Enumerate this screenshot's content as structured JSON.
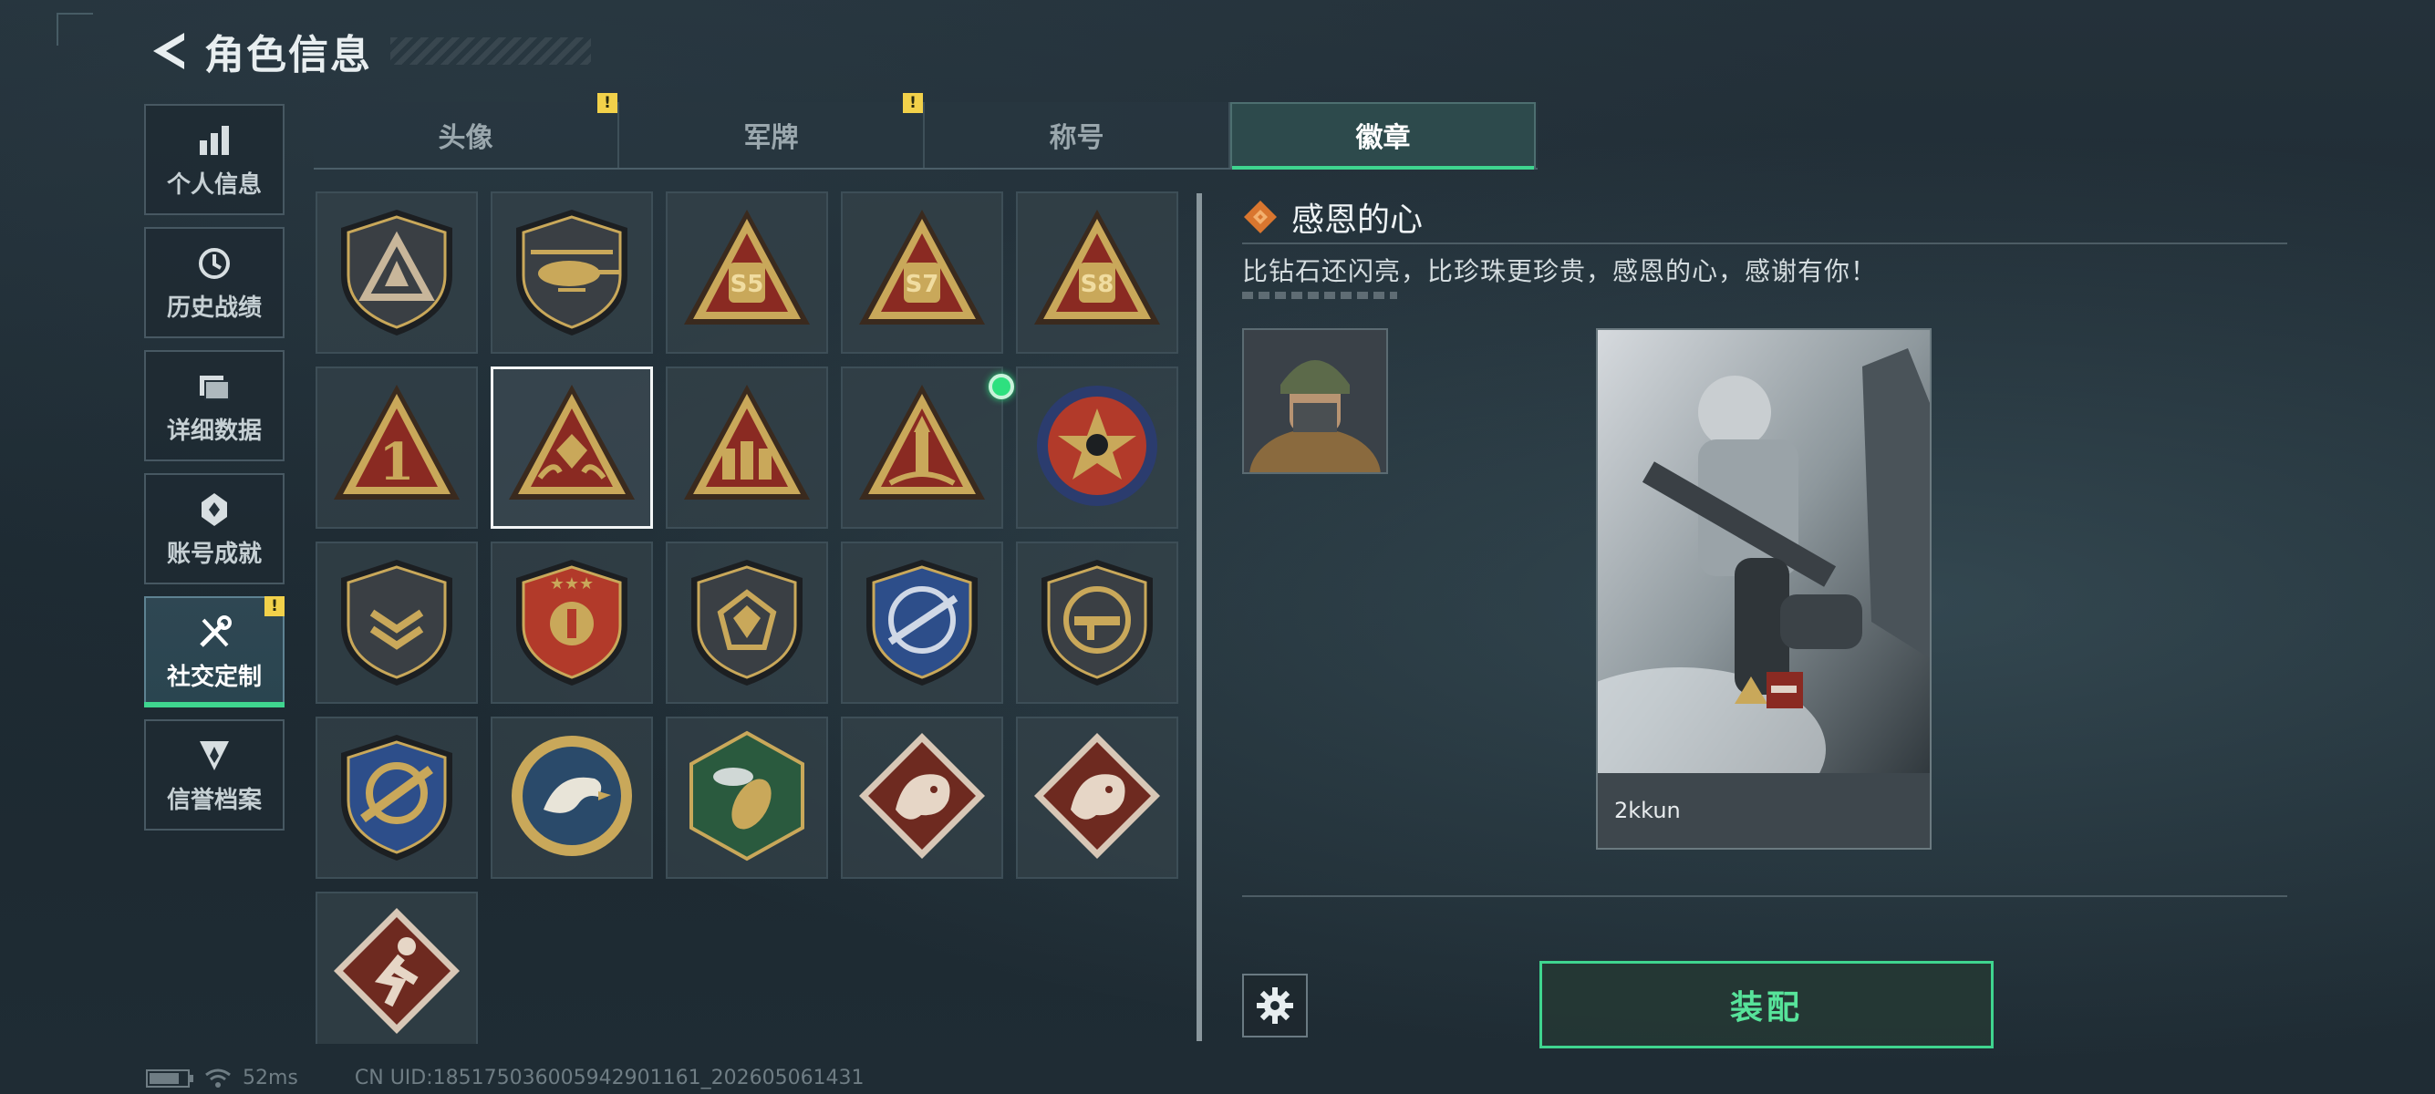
{
  "header": {
    "title": "角色信息"
  },
  "nav": [
    {
      "label": "个人信息",
      "icon": "bar-chart-icon",
      "active": false,
      "warning": false
    },
    {
      "label": "历史战绩",
      "icon": "history-icon",
      "active": false,
      "warning": false
    },
    {
      "label": "详细数据",
      "icon": "folder-icon",
      "active": false,
      "warning": false
    },
    {
      "label": "账号成就",
      "icon": "achievement-icon",
      "active": false,
      "warning": false
    },
    {
      "label": "社交定制",
      "icon": "tools-icon",
      "active": true,
      "warning": true,
      "warning_text": "!"
    },
    {
      "label": "信誉档案",
      "icon": "credit-icon",
      "active": false,
      "warning": false
    }
  ],
  "tabs": [
    {
      "label": "头像",
      "warning": true,
      "warning_text": "!"
    },
    {
      "label": "军牌",
      "warning": true,
      "warning_text": "!"
    },
    {
      "label": "称号",
      "warning": false
    },
    {
      "label": "徽章",
      "active": true,
      "warning": false
    }
  ],
  "badges": [
    {
      "name": "badge-triangle-emblem",
      "icon": "triangle-shield-icon",
      "selected": false
    },
    {
      "name": "badge-helicopter",
      "icon": "helicopter-shield-icon",
      "selected": false
    },
    {
      "name": "badge-s5",
      "icon": "s5-triangle-icon",
      "text": "S5",
      "selected": false
    },
    {
      "name": "badge-s7",
      "icon": "s7-triangle-icon",
      "text": "S7",
      "selected": false
    },
    {
      "name": "badge-s8",
      "icon": "s8-triangle-icon",
      "text": "S8",
      "selected": false
    },
    {
      "name": "badge-number-one",
      "icon": "number-one-triangle-icon",
      "text": "1",
      "selected": false
    },
    {
      "name": "badge-grateful-heart",
      "icon": "diamond-hands-triangle-icon",
      "selected": true
    },
    {
      "name": "badge-soldiers",
      "icon": "soldiers-triangle-icon",
      "selected": false
    },
    {
      "name": "badge-rocket",
      "icon": "rocket-triangle-icon",
      "selected": false,
      "new": true
    },
    {
      "name": "badge-star-ribbon",
      "icon": "star-circle-icon",
      "selected": false
    },
    {
      "name": "badge-chevron-shield",
      "icon": "chevron-shield-icon",
      "selected": false
    },
    {
      "name": "badge-stars-shield",
      "icon": "stars-shield-icon",
      "selected": false
    },
    {
      "name": "badge-gem-shield",
      "icon": "gem-shield-icon",
      "selected": false
    },
    {
      "name": "badge-rifle-crosshair",
      "icon": "rifle-crosshair-icon",
      "selected": false
    },
    {
      "name": "badge-smg-shield",
      "icon": "smg-shield-icon",
      "selected": false
    },
    {
      "name": "badge-rifle-gold",
      "icon": "rifle-gold-icon",
      "selected": false
    },
    {
      "name": "badge-eagle",
      "icon": "eagle-icon",
      "selected": false
    },
    {
      "name": "badge-wasp",
      "icon": "wasp-icon",
      "selected": false
    },
    {
      "name": "badge-dragon-1",
      "icon": "dragon-diamond-icon",
      "selected": false
    },
    {
      "name": "badge-dragon-2",
      "icon": "dragon-diamond-icon",
      "selected": false
    },
    {
      "name": "badge-runner",
      "icon": "runner-diamond-icon",
      "selected": false
    }
  ],
  "detail": {
    "title": "感恩的心",
    "description": "比钻石还闪亮，比珍珠更珍贵，感恩的心，感谢有你！",
    "preview_name": "2kkun"
  },
  "actions": {
    "equip_label": "装配"
  },
  "status": {
    "ping": "52ms",
    "uid": "CN UID:1851750360059429011​61_202605061431"
  },
  "colors": {
    "accent": "#3fd58f",
    "warning": "#f2d14a",
    "badge_gold": "#c9a85a",
    "badge_red": "#8a2a22"
  }
}
